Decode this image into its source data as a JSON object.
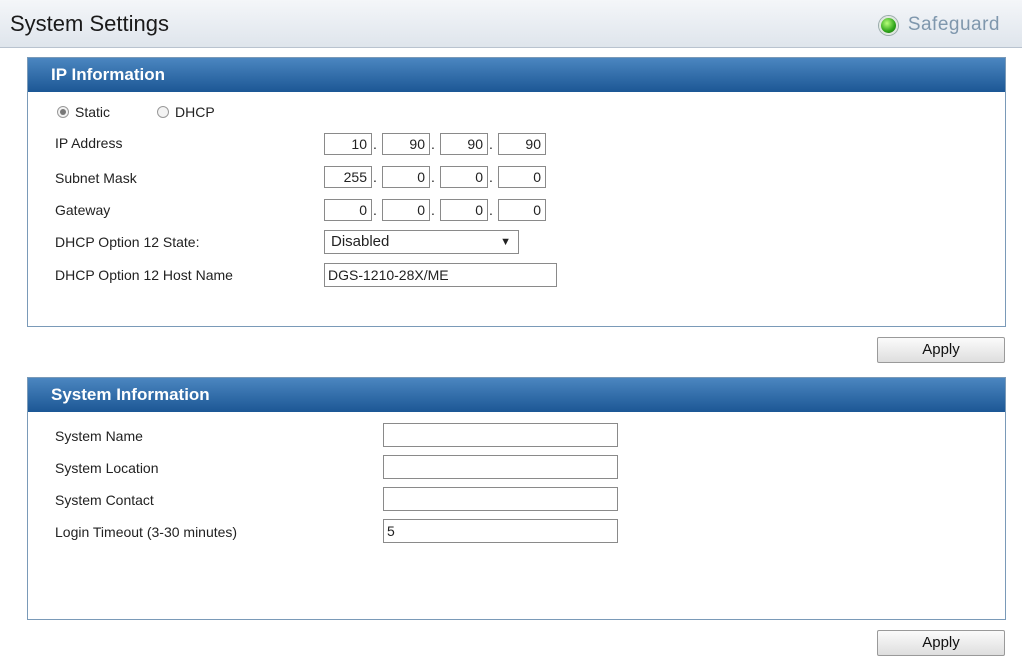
{
  "header": {
    "title": "System Settings",
    "safeguard_label": "Safeguard"
  },
  "ip_info": {
    "title": "IP Information",
    "mode": {
      "static_label": "Static",
      "dhcp_label": "DHCP",
      "selected": "Static"
    },
    "ip_address": {
      "label": "IP Address",
      "octets": [
        "10",
        "90",
        "90",
        "90"
      ]
    },
    "subnet_mask": {
      "label": "Subnet Mask",
      "octets": [
        "255",
        "0",
        "0",
        "0"
      ]
    },
    "gateway": {
      "label": "Gateway",
      "octets": [
        "0",
        "0",
        "0",
        "0"
      ]
    },
    "dhcp_option12_state": {
      "label": "DHCP Option 12 State:",
      "value": "Disabled"
    },
    "dhcp_option12_host": {
      "label": "DHCP Option 12 Host Name",
      "value": "DGS-1210-28X/ME"
    },
    "apply_label": "Apply"
  },
  "sys_info": {
    "title": "System Information",
    "system_name": {
      "label": "System Name",
      "value": ""
    },
    "system_location": {
      "label": "System Location",
      "value": ""
    },
    "system_contact": {
      "label": "System Contact",
      "value": ""
    },
    "login_timeout": {
      "label": "Login Timeout (3-30 minutes)",
      "value": "5"
    },
    "apply_label": "Apply"
  },
  "icons": {
    "safeguard": "status-green-dot-icon",
    "dropdown": "triangle-down-icon"
  },
  "colors": {
    "panel_header": "#1c5795",
    "safeguard_text": "#7f97ad",
    "status_green": "#2ea51a"
  }
}
